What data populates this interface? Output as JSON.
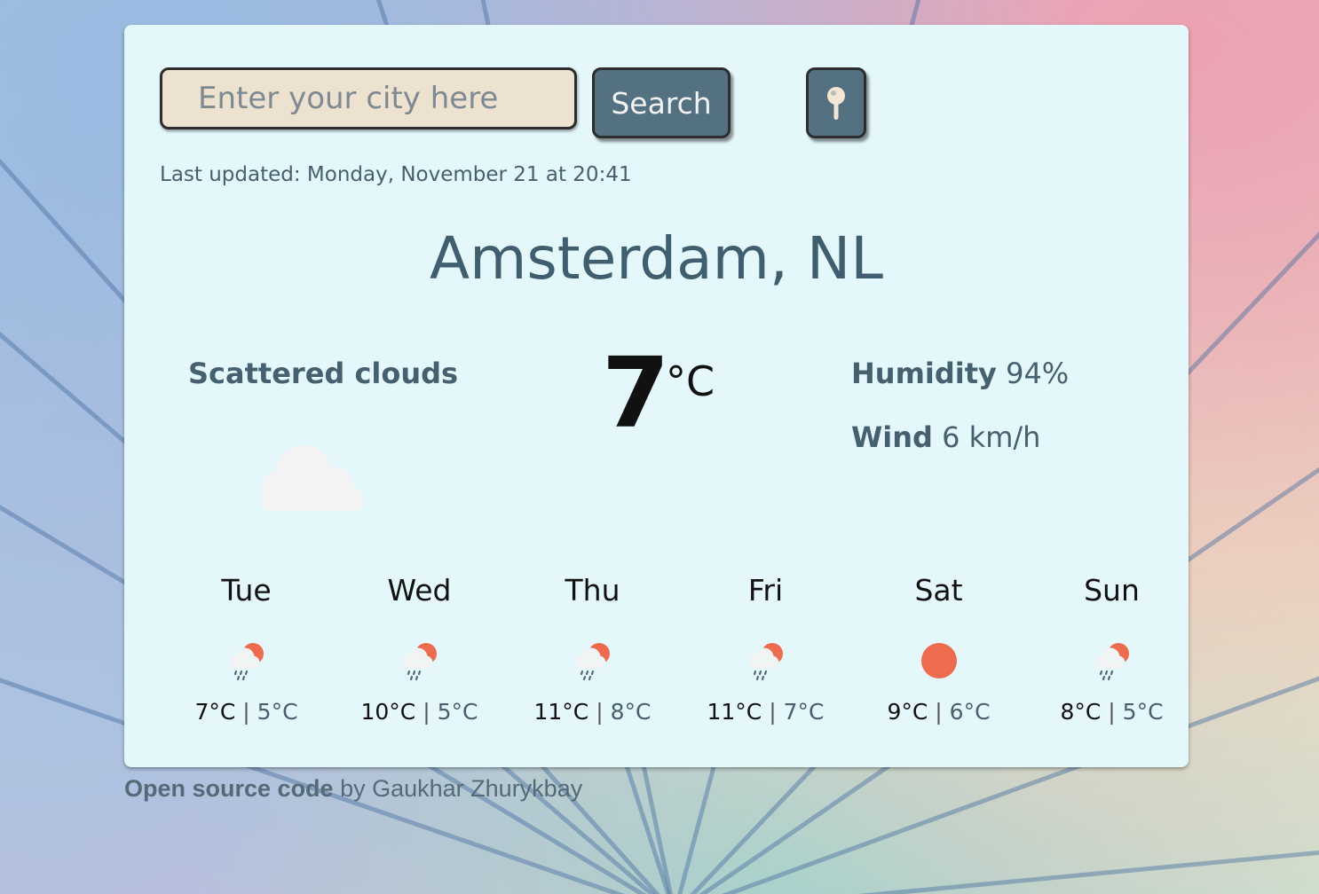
{
  "search": {
    "placeholder": "Enter your city here",
    "value": "",
    "button_label": "Search",
    "location_icon": "location-pin-icon"
  },
  "last_updated": "Last updated: Monday, November 21 at 20:41",
  "city": "Amsterdam, NL",
  "current": {
    "description": "Scattered clouds",
    "icon": "cloud-icon",
    "temperature": "7",
    "unit": "°C",
    "humidity_label": "Humidity",
    "humidity_value": "94%",
    "wind_label": "Wind",
    "wind_value": "6 km/h"
  },
  "forecast": [
    {
      "day": "Tue",
      "icon": "rain-sun-icon",
      "max": "7°C",
      "min": "5°C"
    },
    {
      "day": "Wed",
      "icon": "rain-sun-icon",
      "max": "10°C",
      "min": "5°C"
    },
    {
      "day": "Thu",
      "icon": "rain-sun-icon",
      "max": "11°C",
      "min": "8°C"
    },
    {
      "day": "Fri",
      "icon": "rain-sun-icon",
      "max": "11°C",
      "min": "7°C"
    },
    {
      "day": "Sat",
      "icon": "sun-icon",
      "max": "9°C",
      "min": "6°C"
    },
    {
      "day": "Sun",
      "icon": "rain-sun-icon",
      "max": "8°C",
      "min": "5°C"
    }
  ],
  "forecast_separator": "|",
  "footer": {
    "link_text": "Open source code",
    "rest_text": "by Gaukhar Zhurykbay"
  },
  "colors": {
    "card_background": "#e4f8fb",
    "button_background": "#537180",
    "input_background": "#ede1cf",
    "accent_sun": "#ee6c4d",
    "text_slate": "#45606e"
  }
}
